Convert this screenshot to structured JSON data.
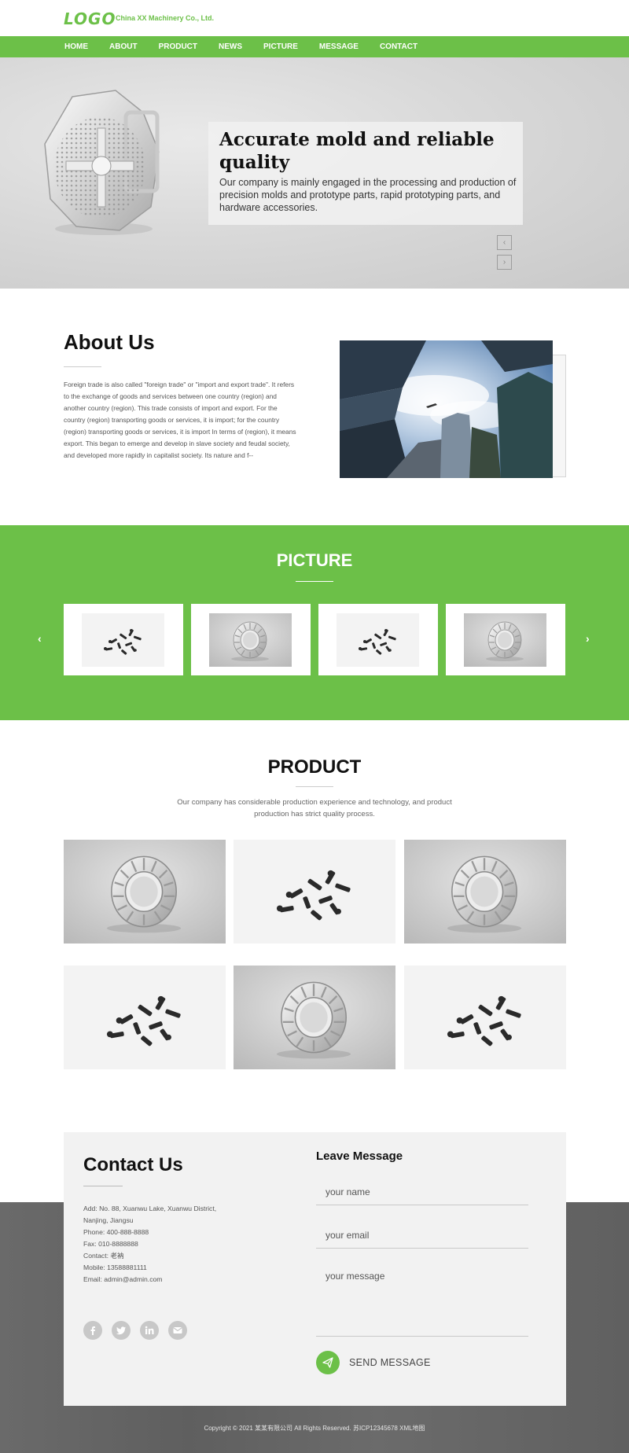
{
  "header": {
    "logo": "LOGO",
    "company": "China XX Machinery Co., Ltd."
  },
  "nav": {
    "items": [
      "HOME",
      "ABOUT",
      "PRODUCT",
      "NEWS",
      "PICTURE",
      "MESSAGE",
      "CONTACT"
    ]
  },
  "banner": {
    "title": "Accurate mold and reliable quality",
    "text": "Our company is mainly engaged in the processing and production of precision molds and prototype parts, rapid prototyping parts, and hardware accessories.",
    "prev_label": "‹",
    "next_label": "›"
  },
  "about": {
    "title": "About Us",
    "text": "Foreign trade is also called \"foreign trade\" or \"import and export trade\". It refers to the exchange of goods and services between one country (region) and another country (region). This trade consists of import and export. For the country (region) transporting goods or services, it is import; for the country (region) transporting goods or services, it is import In terms of (region), it means export. This began to emerge and develop in slave society and feudal society, and developed more rapidly in capitalist society. Its nature and f--"
  },
  "picture": {
    "title": "PICTURE",
    "prev_label": "‹",
    "next_label": "›",
    "items": [
      "screws",
      "ring",
      "screws",
      "ring"
    ]
  },
  "product": {
    "title": "PRODUCT",
    "desc": "Our company has considerable production experience and technology, and product production has strict quality process.",
    "items": [
      "ring",
      "screws",
      "ring",
      "screws",
      "ring",
      "screws"
    ]
  },
  "contact": {
    "title": "Contact Us",
    "address": "Add: No. 88, Xuanwu Lake, Xuanwu District, Nanjing, Jiangsu",
    "phone": "Phone: 400-888-8888",
    "fax": "Fax: 010-8888888",
    "contact": "Contact: 老衲",
    "mobile": "Mobile: 13588881111",
    "email": "Email: admin@admin.com",
    "social_icons": [
      "facebook-icon",
      "twitter-icon",
      "linkedin-icon",
      "mail-icon"
    ]
  },
  "message": {
    "title": "Leave Message",
    "name_placeholder": "your name",
    "email_placeholder": "your email",
    "message_placeholder": "your message",
    "send_label": "SEND MESSAGE"
  },
  "footer": {
    "copyright": "Copyright © 2021 某某有限公司 All Rights Reserved.  苏ICP12345678  XML地图"
  },
  "colors": {
    "accent": "#6cc048",
    "footer": "#666666",
    "contact_box": "#f2f2f2"
  }
}
